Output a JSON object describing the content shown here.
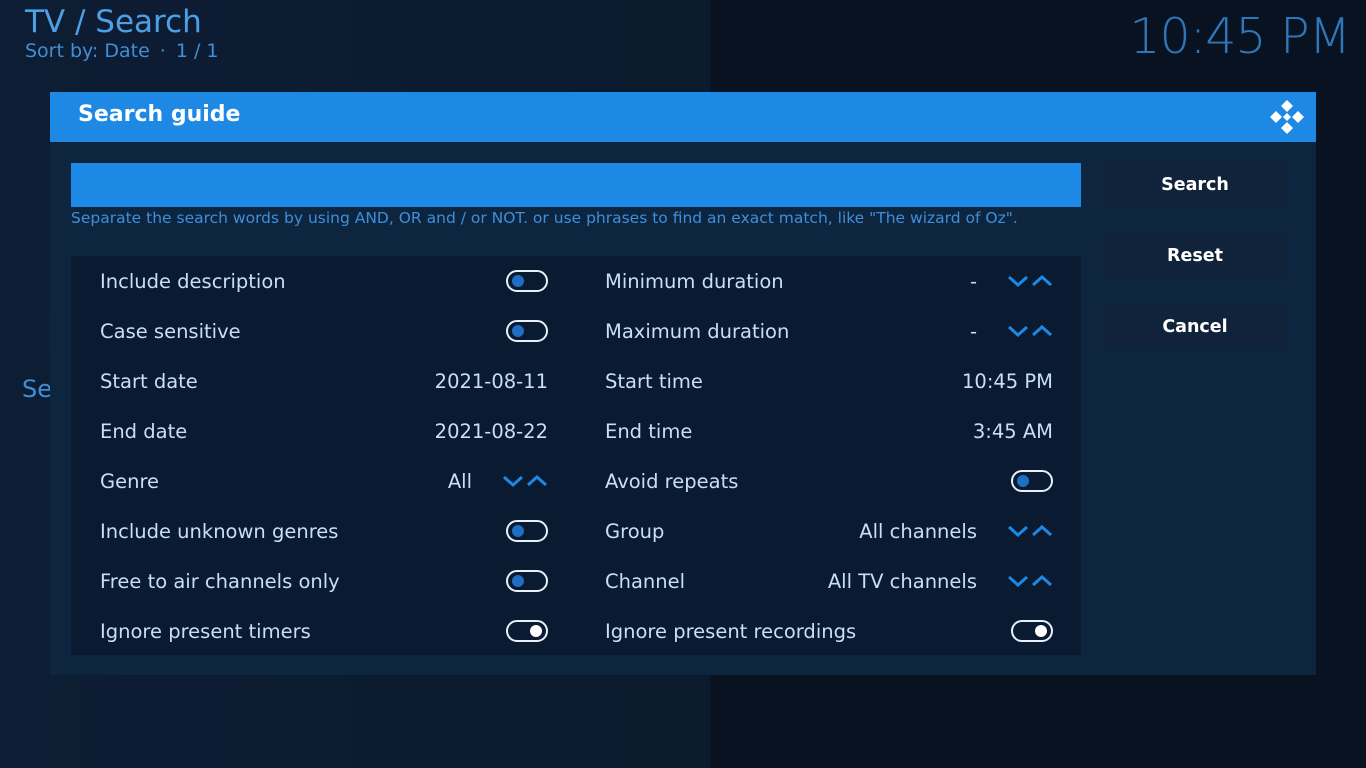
{
  "header": {
    "title": "TV / Search",
    "sort_label": "Sort by: Date",
    "sort_sep": "·",
    "page": "1 / 1",
    "clock": "10:45 PM",
    "background_fragment": "Se"
  },
  "dialog": {
    "title": "Search guide",
    "logo_icon": "kodi-logo-icon",
    "search_input": {
      "value": "",
      "placeholder": ""
    },
    "hint": "Separate the search words by using AND, OR and / or NOT. or use phrases to find an exact match, like \"The wizard of Oz\".",
    "buttons": {
      "search": "Search",
      "reset": "Reset",
      "cancel": "Cancel"
    }
  },
  "settings": {
    "left": [
      {
        "label": "Include description",
        "type": "toggle",
        "on": false
      },
      {
        "label": "Case sensitive",
        "type": "toggle",
        "on": false
      },
      {
        "label": "Start date",
        "type": "value",
        "value": "2021-08-11"
      },
      {
        "label": "End date",
        "type": "value",
        "value": "2021-08-22"
      },
      {
        "label": "Genre",
        "type": "spin",
        "value": "All"
      },
      {
        "label": "Include unknown genres",
        "type": "toggle",
        "on": false
      },
      {
        "label": "Free to air channels only",
        "type": "toggle",
        "on": false
      },
      {
        "label": "Ignore present timers",
        "type": "toggle",
        "on": true
      }
    ],
    "right": [
      {
        "label": "Minimum duration",
        "type": "spin",
        "value": "-"
      },
      {
        "label": "Maximum duration",
        "type": "spin",
        "value": "-"
      },
      {
        "label": "Start time",
        "type": "value",
        "value": "10:45 PM"
      },
      {
        "label": "End time",
        "type": "value",
        "value": "3:45 AM"
      },
      {
        "label": "Avoid repeats",
        "type": "toggle",
        "on": false
      },
      {
        "label": "Group",
        "type": "spin",
        "value": "All channels"
      },
      {
        "label": "Channel",
        "type": "spin",
        "value": "All TV channels"
      },
      {
        "label": "Ignore present recordings",
        "type": "toggle",
        "on": true
      }
    ]
  },
  "colors": {
    "accent": "#1e88e5",
    "toggle_on_knob": "#ffffff",
    "toggle_off_knob": "#1e6fc4",
    "text_light": "#c9dff4",
    "text_blue": "#3d8fda"
  }
}
